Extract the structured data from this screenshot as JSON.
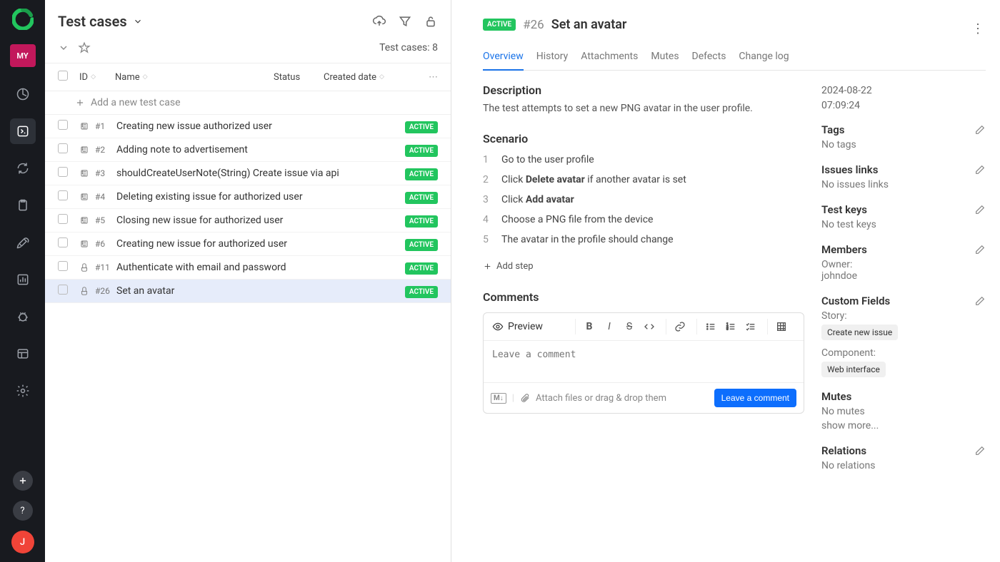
{
  "sidebar": {
    "project_initials": "MY",
    "user_initial": "J"
  },
  "mid": {
    "title": "Test cases",
    "count_label": "Test cases: 8",
    "headers": {
      "id": "ID",
      "name": "Name",
      "status": "Status",
      "created": "Created date"
    },
    "add_row": "Add a new test case",
    "rows": [
      {
        "id": "#1",
        "name": "Creating new issue authorized user",
        "status": "ACTIVE",
        "manual": false
      },
      {
        "id": "#2",
        "name": "Adding note to advertisement",
        "status": "ACTIVE",
        "manual": false
      },
      {
        "id": "#3",
        "name": "shouldCreateUserNote(String) Create issue via api",
        "status": "ACTIVE",
        "manual": false
      },
      {
        "id": "#4",
        "name": "Deleting existing issue for authorized user",
        "status": "ACTIVE",
        "manual": false
      },
      {
        "id": "#5",
        "name": "Closing new issue for authorized user",
        "status": "ACTIVE",
        "manual": false
      },
      {
        "id": "#6",
        "name": "Creating new issue for authorized user",
        "status": "ACTIVE",
        "manual": false
      },
      {
        "id": "#11",
        "name": "Authenticate with email and password",
        "status": "ACTIVE",
        "manual": true
      },
      {
        "id": "#26",
        "name": "Set an avatar",
        "status": "ACTIVE",
        "manual": true,
        "selected": true
      }
    ]
  },
  "detail": {
    "status": "ACTIVE",
    "id": "#26",
    "title": "Set an avatar",
    "tabs": [
      "Overview",
      "History",
      "Attachments",
      "Mutes",
      "Defects",
      "Change log"
    ],
    "description_label": "Description",
    "description": "The test attempts to set a new PNG avatar in the user profile.",
    "scenario_label": "Scenario",
    "steps": [
      {
        "n": "1",
        "text": "Go to the user profile"
      },
      {
        "n": "2",
        "pre": "Click ",
        "bold": "Delete avatar",
        "post": " if another avatar is set"
      },
      {
        "n": "3",
        "pre": "Click ",
        "bold": "Add avatar",
        "post": ""
      },
      {
        "n": "4",
        "text": "Choose a PNG file from the device"
      },
      {
        "n": "5",
        "text": "The avatar in the profile should change"
      }
    ],
    "add_step": "Add step",
    "comments_label": "Comments",
    "preview": "Preview",
    "comment_placeholder": "Leave a comment",
    "attach_hint": "Attach files or drag & drop them",
    "leave_comment_btn": "Leave a comment"
  },
  "meta": {
    "date": "2024-08-22",
    "time": "07:09:24",
    "tags_label": "Tags",
    "tags_empty": "No tags",
    "links_label": "Issues links",
    "links_empty": "No issues links",
    "keys_label": "Test keys",
    "keys_empty": "No test keys",
    "members_label": "Members",
    "owner_label": "Owner:",
    "owner": "johndoe",
    "custom_label": "Custom Fields",
    "story_label": "Story:",
    "story_value": "Create new issue",
    "component_label": "Component:",
    "component_value": "Web interface",
    "mutes_label": "Mutes",
    "mutes_empty": "No mutes",
    "show_more": "show more...",
    "relations_label": "Relations",
    "relations_empty": "No relations"
  }
}
